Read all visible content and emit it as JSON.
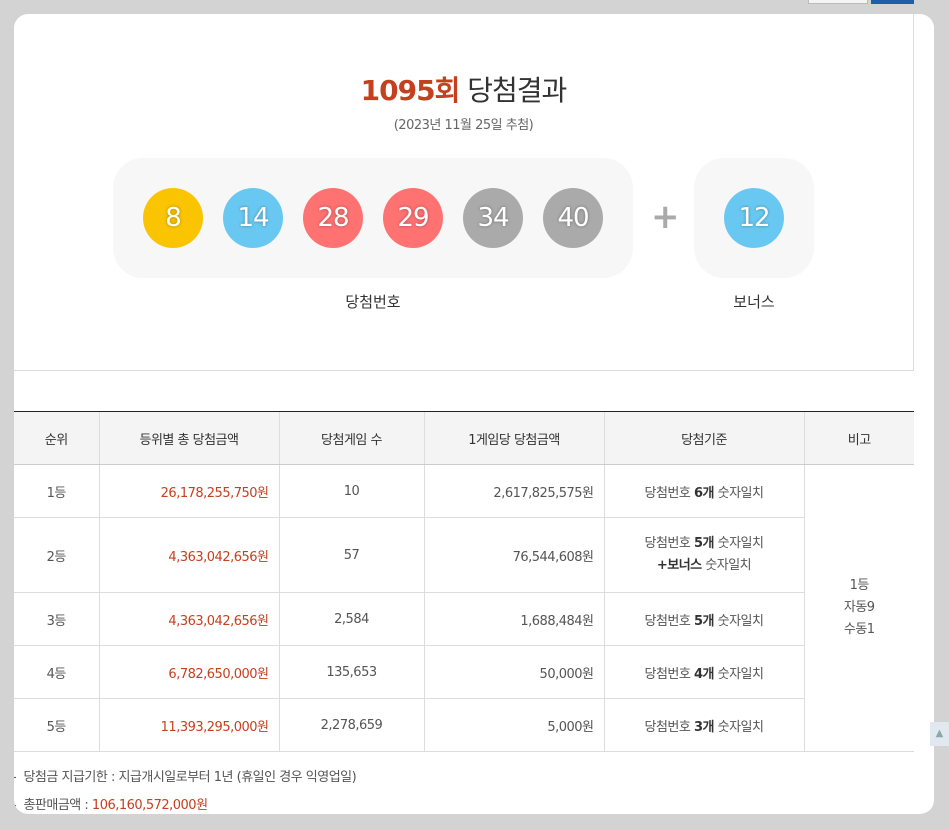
{
  "draw": {
    "round": "1095회",
    "title_suffix": "당첨결과",
    "date": "(2023년 11월 25일 추첨)",
    "numbers": [
      {
        "value": "8",
        "color": "#fbc400"
      },
      {
        "value": "14",
        "color": "#69c8f2"
      },
      {
        "value": "28",
        "color": "#ff7272"
      },
      {
        "value": "29",
        "color": "#ff7272"
      },
      {
        "value": "34",
        "color": "#aaaaaa"
      },
      {
        "value": "40",
        "color": "#aaaaaa"
      }
    ],
    "plus_sign": "+",
    "bonus": {
      "value": "12",
      "color": "#69c8f2"
    },
    "numbers_caption": "당첨번호",
    "bonus_caption": "보너스"
  },
  "table": {
    "headers": [
      "순위",
      "등위별 총 당첨금액",
      "당첨게임 수",
      "1게임당 당첨금액",
      "당첨기준",
      "비고"
    ],
    "rows": [
      {
        "rank": "1등",
        "total": "26,178,255,750원",
        "winners": "10",
        "per_game": "2,617,825,575원",
        "rule_pre": "당첨번호 ",
        "rule_bold": "6개",
        "rule_post": " 숫자일치"
      },
      {
        "rank": "2등",
        "total": "4,363,042,656원",
        "winners": "57",
        "per_game": "76,544,608원",
        "rule_pre": "당첨번호 ",
        "rule_bold": "5개",
        "rule_post": " 숫자일치",
        "rule2_bold": "+보너스",
        "rule2_post": " 숫자일치"
      },
      {
        "rank": "3등",
        "total": "4,363,042,656원",
        "winners": "2,584",
        "per_game": "1,688,484원",
        "rule_pre": "당첨번호 ",
        "rule_bold": "5개",
        "rule_post": " 숫자일치"
      },
      {
        "rank": "4등",
        "total": "6,782,650,000원",
        "winners": "135,653",
        "per_game": "50,000원",
        "rule_pre": "당첨번호 ",
        "rule_bold": "4개",
        "rule_post": " 숫자일치"
      },
      {
        "rank": "5등",
        "total": "11,393,295,000원",
        "winners": "2,278,659",
        "per_game": "5,000원",
        "rule_pre": "당첨번호 ",
        "rule_bold": "3개",
        "rule_post": " 숫자일치"
      }
    ],
    "note_lines": [
      "1등",
      "자동9",
      "수동1"
    ]
  },
  "footer": {
    "deadline_text": "당첨금 지급기한 : 지급개시일로부터 1년 (휴일인 경우 익영업일)",
    "sales_label": "총판매금액 : ",
    "sales_value": "106,160,572,000원"
  }
}
